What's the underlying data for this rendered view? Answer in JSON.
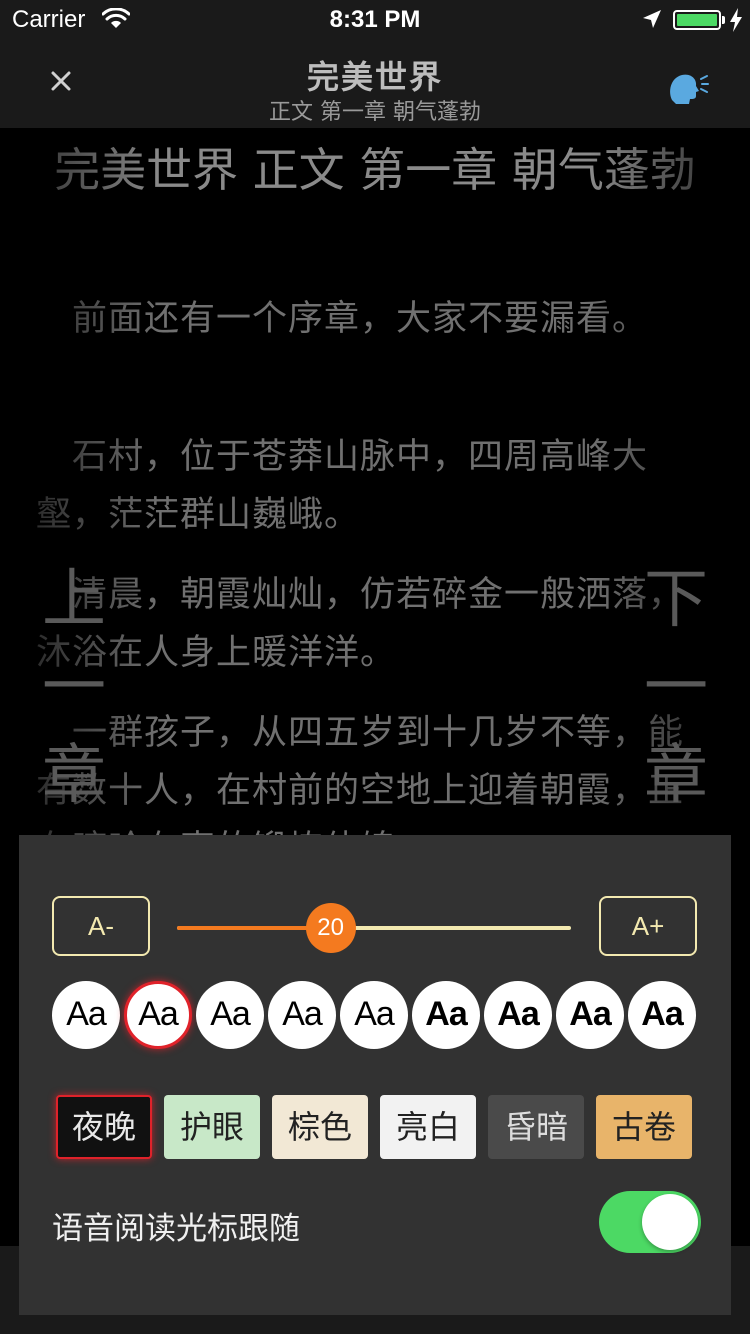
{
  "status_bar": {
    "carrier": "Carrier",
    "time": "8:31 PM",
    "battery_level": 1.0,
    "battery_color": "#4cd964"
  },
  "nav": {
    "title": "完美世界",
    "subtitle": "正文 第一章 朝气蓬勃",
    "close_icon": "close-icon",
    "speak_icon": "speaking-head-icon"
  },
  "reader": {
    "chapter_title": "完美世界 正文 第一章 朝气蓬勃",
    "paragraphs": [
      "前面还有一个序章，大家不要漏看。",
      "石村，位于苍莽山脉中，四周高峰大壑，茫茫群山巍峨。",
      "清晨，朝霞灿灿，仿若碎金一般洒落，沐浴在人身上暖洋洋。",
      "一群孩子，从四五岁到十几岁不等，能有数十人，在村前的空地上迎着朝霞，正在哼哈有声的锻炼体魄。"
    ],
    "prev_chapter": "上一章",
    "next_chapter": "下一章"
  },
  "settings": {
    "font_decrease": "A-",
    "font_increase": "A+",
    "font_size": 20,
    "font_size_fraction": 0.39,
    "accent_color": "#f47a1f",
    "font_faces": [
      "Aa",
      "Aa",
      "Aa",
      "Aa",
      "Aa",
      "Aa",
      "Aa",
      "Aa",
      "Aa"
    ],
    "font_weights": [
      100,
      200,
      300,
      400,
      500,
      600,
      700,
      800,
      900
    ],
    "selected_face": 1,
    "themes": [
      {
        "label": "夜晚",
        "bg": "#111111",
        "fg": "#e8e8e8",
        "selected": true
      },
      {
        "label": "护眼",
        "bg": "#c8e8c8",
        "fg": "#222222",
        "selected": false
      },
      {
        "label": "棕色",
        "bg": "#f2e8d5",
        "fg": "#222222",
        "selected": false
      },
      {
        "label": "亮白",
        "bg": "#f2f2f2",
        "fg": "#222222",
        "selected": false
      },
      {
        "label": "昏暗",
        "bg": "#4a4a4a",
        "fg": "#dddddd",
        "selected": false
      },
      {
        "label": "古卷",
        "bg": "#e8b46a",
        "fg": "#222222",
        "selected": false
      }
    ],
    "follow_label": "语音阅读光标跟随",
    "follow_enabled": true
  }
}
